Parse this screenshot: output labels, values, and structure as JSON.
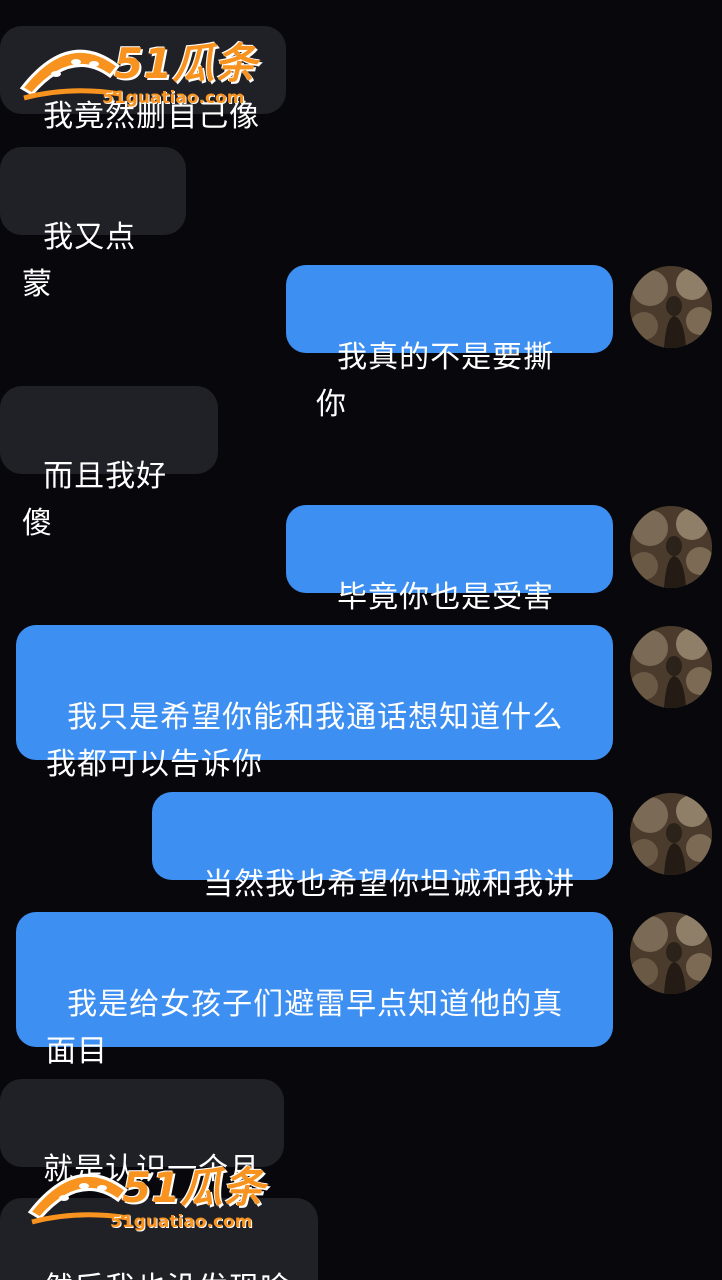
{
  "chat": {
    "messages": [
      {
        "side": "in",
        "text": "我竟然删自己像"
      },
      {
        "side": "in",
        "text": "我又点蒙"
      },
      {
        "side": "out",
        "text": "我真的不是要撕你"
      },
      {
        "side": "in",
        "text": "而且我好傻"
      },
      {
        "side": "out",
        "text": "毕竟你也是受害者"
      },
      {
        "side": "out",
        "text": "我只是希望你能和我通话想知道什么\n我都可以告诉你"
      },
      {
        "side": "out",
        "text": "当然我也希望你坦诚和我讲"
      },
      {
        "side": "out",
        "text": "我是给女孩子们避雷早点知道他的真\n面目"
      },
      {
        "side": "in",
        "text": "就是认识一个月"
      },
      {
        "side": "in",
        "text": "然后我也没发现啥"
      }
    ]
  },
  "watermark": {
    "brand": "51瓜条",
    "url": "51guatiao.com"
  },
  "colors": {
    "background": "#07070c",
    "incoming_bubble": "#202027",
    "outgoing_bubble": "#3d8ff2",
    "watermark": "#f7931e"
  },
  "icons": {
    "avatar": "user-avatar-photo",
    "watermark_logo": "watermelon-slice-icon"
  }
}
